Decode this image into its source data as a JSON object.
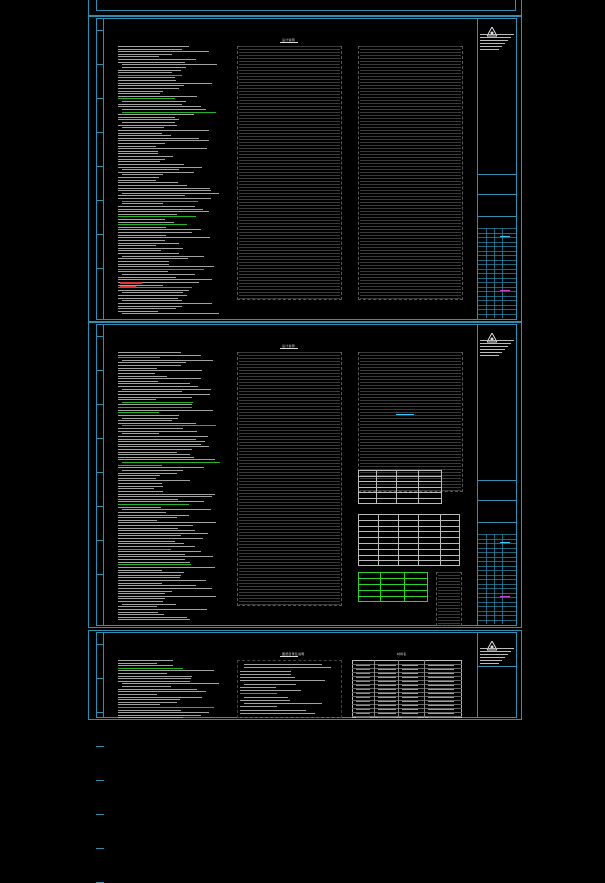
{
  "colors": {
    "background": "#000000",
    "frame": "#2f8fb0",
    "text": "#cccccc",
    "heading_green": "#28d428",
    "highlight_cyan": "#2cc7ff",
    "warning_red": "#e33333",
    "dashed_column": "#5a5a5a"
  },
  "sheets": [
    {
      "id": "sheet-1",
      "center_title": "设计说明",
      "has_tables": false
    },
    {
      "id": "sheet-2",
      "center_title": "设计说明",
      "has_tables": true
    },
    {
      "id": "sheet-3",
      "center_title": "图纸目录及说明",
      "right_title": "材料表",
      "has_tables": true
    }
  ],
  "icons": [
    "company-logo-icon"
  ]
}
